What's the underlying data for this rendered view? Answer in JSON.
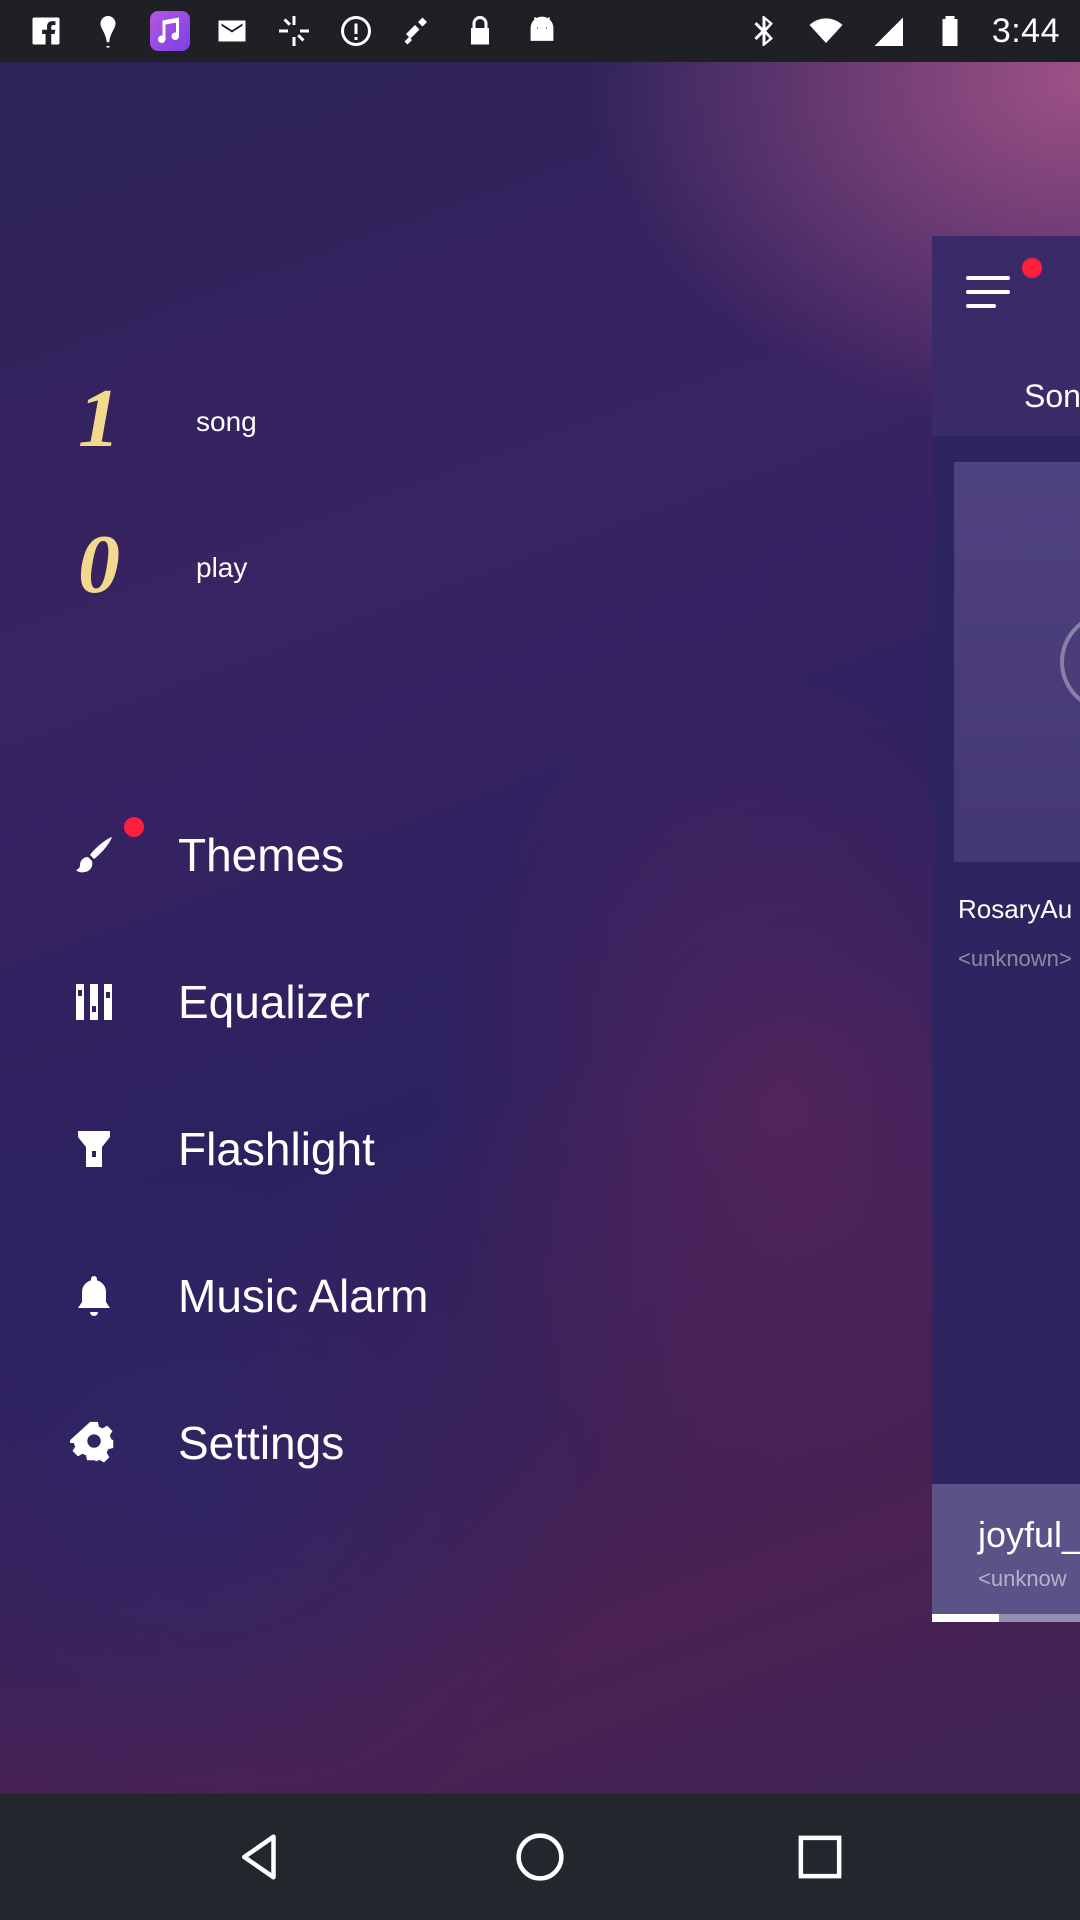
{
  "status_bar": {
    "time": "3:44",
    "left_icons": [
      "facebook-icon",
      "location-pin-icon",
      "music-app-icon",
      "mail-icon",
      "sync-icon",
      "info-icon",
      "fake-gps-icon",
      "lock-icon",
      "android-icon"
    ],
    "right_icons": [
      "bluetooth-icon",
      "wifi-icon",
      "signal-icon",
      "battery-icon"
    ]
  },
  "drawer": {
    "stats": [
      {
        "value": "1",
        "label": "song"
      },
      {
        "value": "0",
        "label": "play"
      }
    ],
    "menu": [
      {
        "label": "Themes",
        "icon": "paintbrush-icon",
        "badge": true
      },
      {
        "label": "Equalizer",
        "icon": "equalizer-icon",
        "badge": false
      },
      {
        "label": "Flashlight",
        "icon": "flashlight-icon",
        "badge": false
      },
      {
        "label": "Music Alarm",
        "icon": "bell-icon",
        "badge": false
      },
      {
        "label": "Settings",
        "icon": "gear-icon",
        "badge": false
      }
    ]
  },
  "main_peek": {
    "tab_label": "Son",
    "song_title": "RosaryAu",
    "song_artist": "<unknown>",
    "player": {
      "title": "joyful_",
      "artist": "<unknow",
      "progress_fraction": 0.45
    }
  },
  "colors": {
    "stat_number": "#f3d98e",
    "badge": "#ff1e3c",
    "status_bar": "#1f1f26",
    "nav_bar": "#23262d"
  }
}
